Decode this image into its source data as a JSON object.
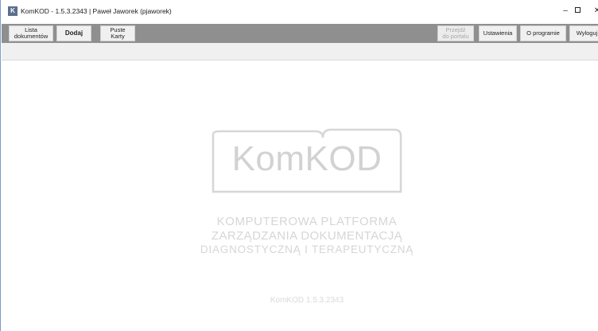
{
  "window": {
    "icon_letter": "K",
    "title": "KomKOD - 1.5.3.2343 | Paweł Jaworek (pjaworek)",
    "minimize": "–",
    "close": "✕"
  },
  "toolbar": {
    "lista_line1": "Lista",
    "lista_line2": "dokumentów",
    "dodaj": "Dodaj",
    "puste_line1": "Puste",
    "puste_line2": "Karty",
    "portal_line1": "Przejdź",
    "portal_line2": "do portalu",
    "ustawienia": "Ustawienia",
    "o_programie": "O programie",
    "wyloguj": "Wyloguj"
  },
  "splash": {
    "logo": "KomKOD",
    "line1": "KOMPUTEROWA  PLATFORMA",
    "line2": "ZARZĄDZANIA DOKUMENTACJĄ",
    "line3": "DIAGNOSTYCZNĄ  I  TERAPEUTYCZNĄ",
    "version": "KomKOD  1.5.3.2343"
  },
  "colors": {
    "toolbar_bg": "#8f8f8f",
    "button_bg": "#f0f0f0",
    "logo_gray": "#d2d2d2",
    "window_border": "#7a9cc6"
  }
}
